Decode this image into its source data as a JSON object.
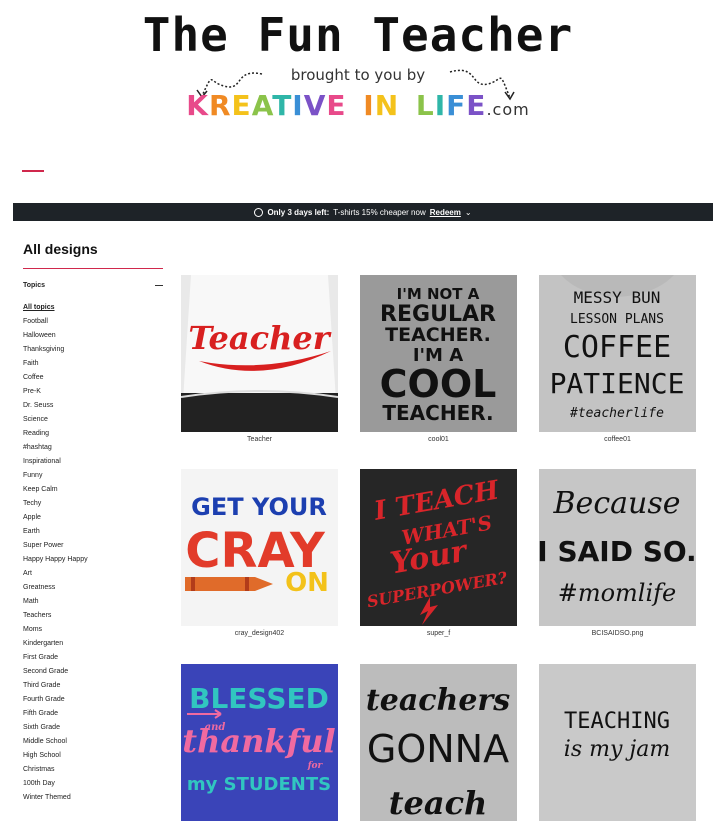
{
  "header": {
    "title": "The Fun Teacher",
    "subtitle": "brought to you by",
    "brand_letters": [
      {
        "ch": "K",
        "c": "#e84a8a"
      },
      {
        "ch": "R",
        "c": "#f08a24"
      },
      {
        "ch": "E",
        "c": "#f4c21b"
      },
      {
        "ch": "A",
        "c": "#8bc34a"
      },
      {
        "ch": "T",
        "c": "#2fb6a8"
      },
      {
        "ch": "I",
        "c": "#3a8fd6"
      },
      {
        "ch": "V",
        "c": "#7b52c7"
      },
      {
        "ch": "E",
        "c": "#e84a8a"
      },
      {
        "ch": " ",
        "c": "#000"
      },
      {
        "ch": "I",
        "c": "#f08a24"
      },
      {
        "ch": "N",
        "c": "#f4c21b"
      },
      {
        "ch": " ",
        "c": "#000"
      },
      {
        "ch": "L",
        "c": "#8bc34a"
      },
      {
        "ch": "I",
        "c": "#2fb6a8"
      },
      {
        "ch": "F",
        "c": "#3a8fd6"
      },
      {
        "ch": "E",
        "c": "#7b52c7"
      }
    ],
    "brand_domain": ".com"
  },
  "promo": {
    "prefix": "Only 3 days left:",
    "message": "T-shirts 15% cheaper now",
    "link": "Redeem",
    "icon": "clock-icon"
  },
  "page_title": "All designs",
  "sidebar": {
    "heading": "Topics",
    "items": [
      "All topics",
      "Football",
      "Halloween",
      "Thanksgiving",
      "Faith",
      "Coffee",
      "Pre-K",
      "Dr. Seuss",
      "Science",
      "Reading",
      "#hashtag",
      "Inspirational",
      "Funny",
      "Keep Calm",
      "Techy",
      "Apple",
      "Earth",
      "Super Power",
      "Happy Happy Happy",
      "Art",
      "Greatness",
      "Math",
      "Teachers",
      "Moms",
      "Kindergarten",
      "First Grade",
      "Second Grade",
      "Third Grade",
      "Fourth Grade",
      "Fifth Grade",
      "Sixth Grade",
      "Middle School",
      "High School",
      "Christmas",
      "100th Day",
      "Winter Themed"
    ]
  },
  "designs": [
    {
      "caption": "Teacher",
      "lines": [
        "Teacher"
      ]
    },
    {
      "caption": "cool01",
      "lines": [
        "I'M NOT A",
        "REGULAR",
        "TEACHER.",
        "I'M A",
        "COOL",
        "TEACHER."
      ]
    },
    {
      "caption": "coffee01",
      "lines": [
        "MESSY BUN",
        "LESSON PLANS",
        "COFFEE",
        "PATIENCE",
        "#teacherlife"
      ]
    },
    {
      "caption": "cray_design402",
      "lines": [
        "GET YOUR",
        "CRAY",
        "ON"
      ]
    },
    {
      "caption": "super_f",
      "lines": [
        "I TEACH",
        "WHAT'S",
        "Your",
        "SUPERPOWER?"
      ]
    },
    {
      "caption": "BCISAIDSO.png",
      "lines": [
        "Because",
        "I SAID SO.",
        "#momlife"
      ]
    },
    {
      "caption": "",
      "lines": [
        "BLESSED",
        "and",
        "thankful",
        "for",
        "my STUDENTS"
      ]
    },
    {
      "caption": "",
      "lines": [
        "teachers",
        "GONNA",
        "teach"
      ]
    },
    {
      "caption": "",
      "lines": [
        "TEACHING",
        "is my jam"
      ]
    }
  ]
}
